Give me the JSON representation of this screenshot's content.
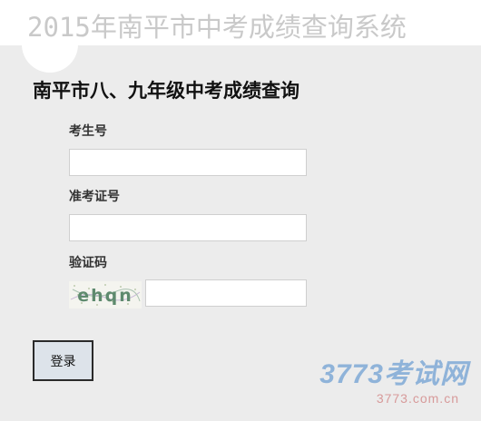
{
  "banner": {
    "title": "2015年南平市中考成绩查询系统"
  },
  "page": {
    "heading": "南平市八、九年级中考成绩查询"
  },
  "form": {
    "exam_no": {
      "label": "考生号",
      "value": "",
      "placeholder": ""
    },
    "ticket_no": {
      "label": "准考证号",
      "value": "",
      "placeholder": ""
    },
    "captcha": {
      "label": "验证码",
      "image_text": "ehqn",
      "value": "",
      "placeholder": ""
    },
    "submit_label": "登录"
  },
  "watermark": {
    "logo_text": "3773考试网",
    "url_text": "3773.com.cn"
  },
  "colors": {
    "background": "#ececec",
    "banner_text": "#c9c9c9",
    "button_bg": "#dde3ea",
    "watermark_blue": "#8fb3d9",
    "watermark_red": "#d79a9a"
  }
}
